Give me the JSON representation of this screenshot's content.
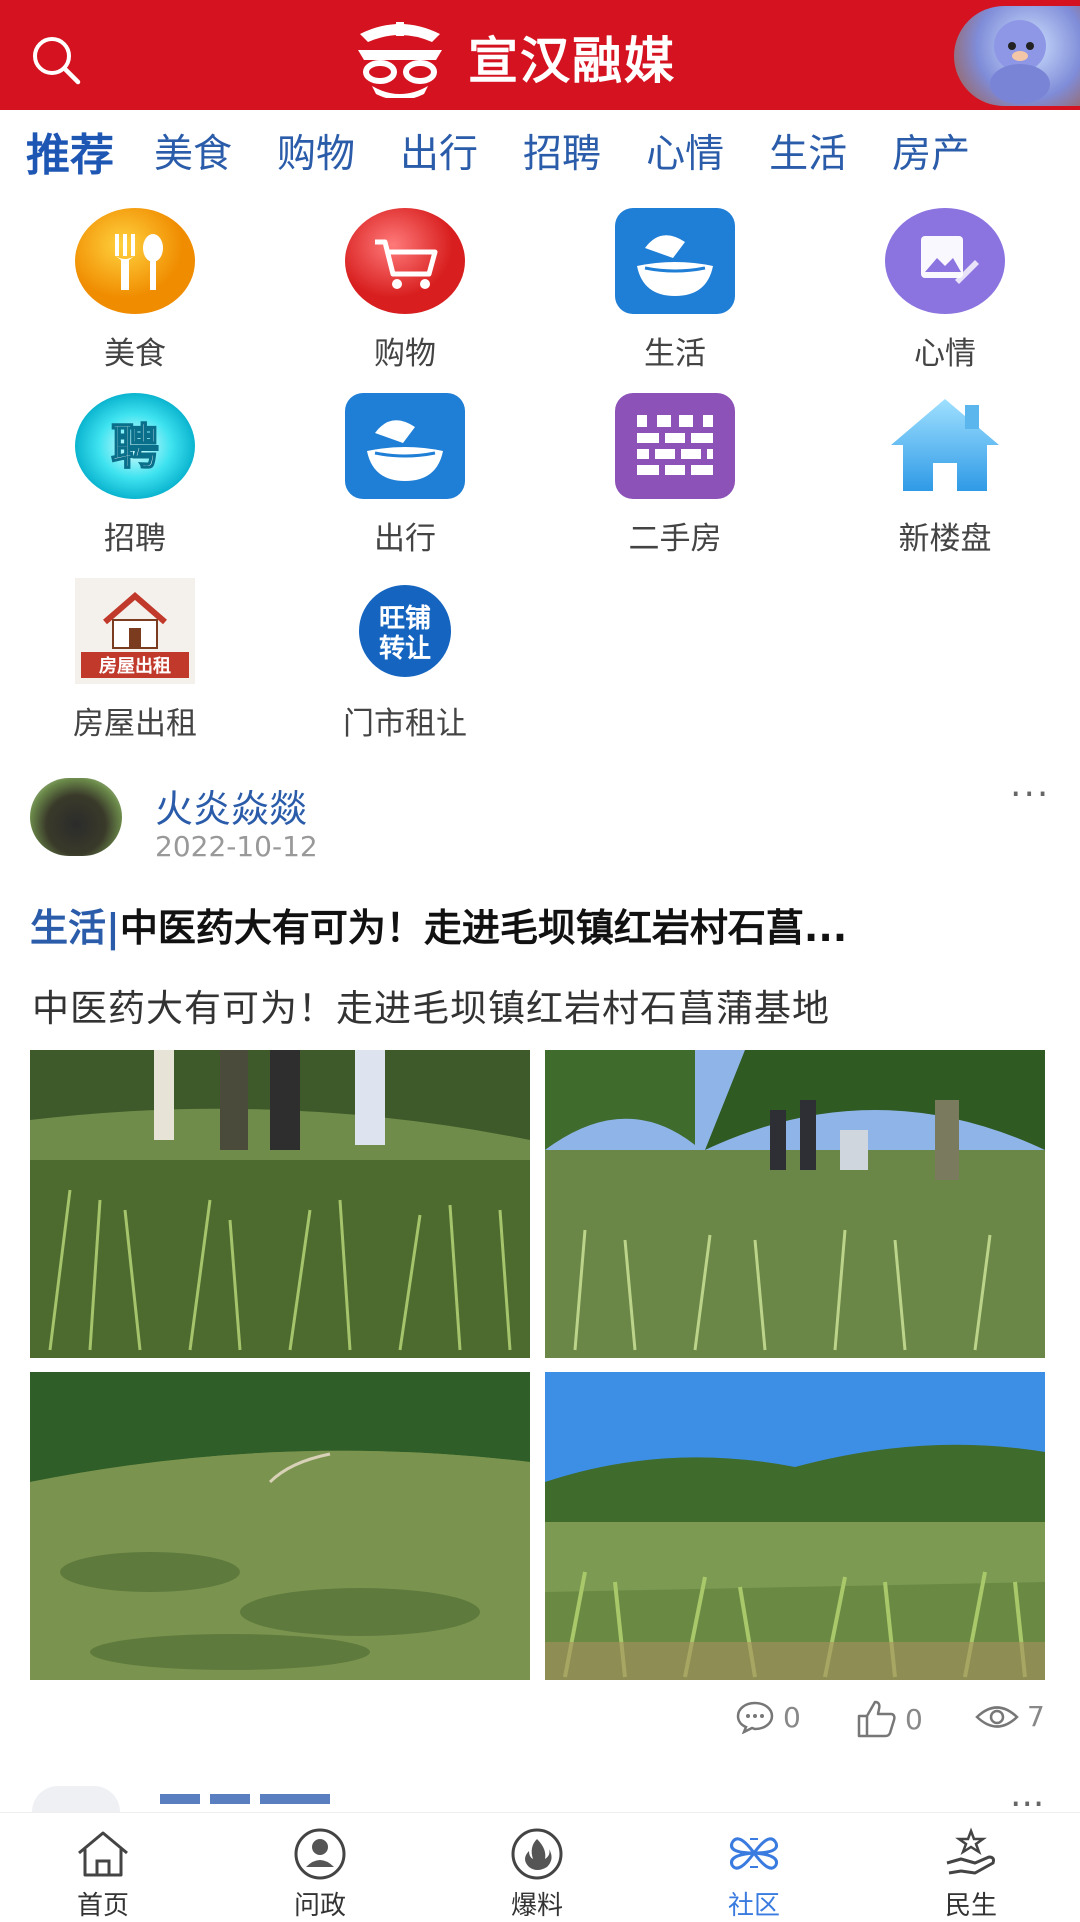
{
  "header": {
    "app_title": "宣汉融媒",
    "search_icon": "search-icon",
    "avatar": "user-avatar"
  },
  "tabs": [
    "推荐",
    "美食",
    "购物",
    "出行",
    "招聘",
    "心情",
    "生活",
    "房产"
  ],
  "grid": [
    {
      "label": "美食",
      "icon": "fork-spoon-icon",
      "color": "#f5a200"
    },
    {
      "label": "购物",
      "icon": "cart-icon",
      "color": "#e53b3b"
    },
    {
      "label": "生活",
      "icon": "bowl-icon",
      "color": "#1f7ed6"
    },
    {
      "label": "心情",
      "icon": "picture-edit-icon",
      "color": "#8b73e0"
    },
    {
      "label": "招聘",
      "icon": "hire-icon",
      "icon_text": "聘",
      "color": "#1fd3e6"
    },
    {
      "label": "出行",
      "icon": "bowl-icon",
      "color": "#1f7ed6"
    },
    {
      "label": "二手房",
      "icon": "brick-wall-icon",
      "color": "#8c52b8"
    },
    {
      "label": "新楼盘",
      "icon": "house-icon",
      "color": "#56b8f2"
    },
    {
      "label": "房屋出租",
      "icon": "house-rent-icon",
      "icon_text": "房屋出租",
      "color": "#c0392b"
    },
    {
      "label": "门市租让",
      "icon": "shop-transfer-icon",
      "icon_text": "旺铺转让",
      "color": "#1565c0"
    }
  ],
  "post": {
    "author": "火炎焱燚",
    "date": "2022-10-12",
    "category": "生活|",
    "title": "中医药大有可为！走进毛坝镇红岩村石菖...",
    "summary": "中医药大有可为！走进毛坝镇红岩村石菖蒲基地",
    "comments": "0",
    "likes": "0",
    "views": "7",
    "more": "···"
  },
  "next_post": {
    "more": "···"
  },
  "bottom_nav": [
    {
      "label": "首页",
      "icon": "home-icon",
      "active": false
    },
    {
      "label": "问政",
      "icon": "person-icon",
      "active": false
    },
    {
      "label": "爆料",
      "icon": "fire-icon",
      "active": false
    },
    {
      "label": "社区",
      "icon": "clover-icon",
      "active": true
    },
    {
      "label": "民生",
      "icon": "hand-star-icon",
      "active": false
    }
  ],
  "colors": {
    "header_red": "#d5121f",
    "accent_blue": "#2a5caa",
    "nav_active": "#3a7be0"
  }
}
